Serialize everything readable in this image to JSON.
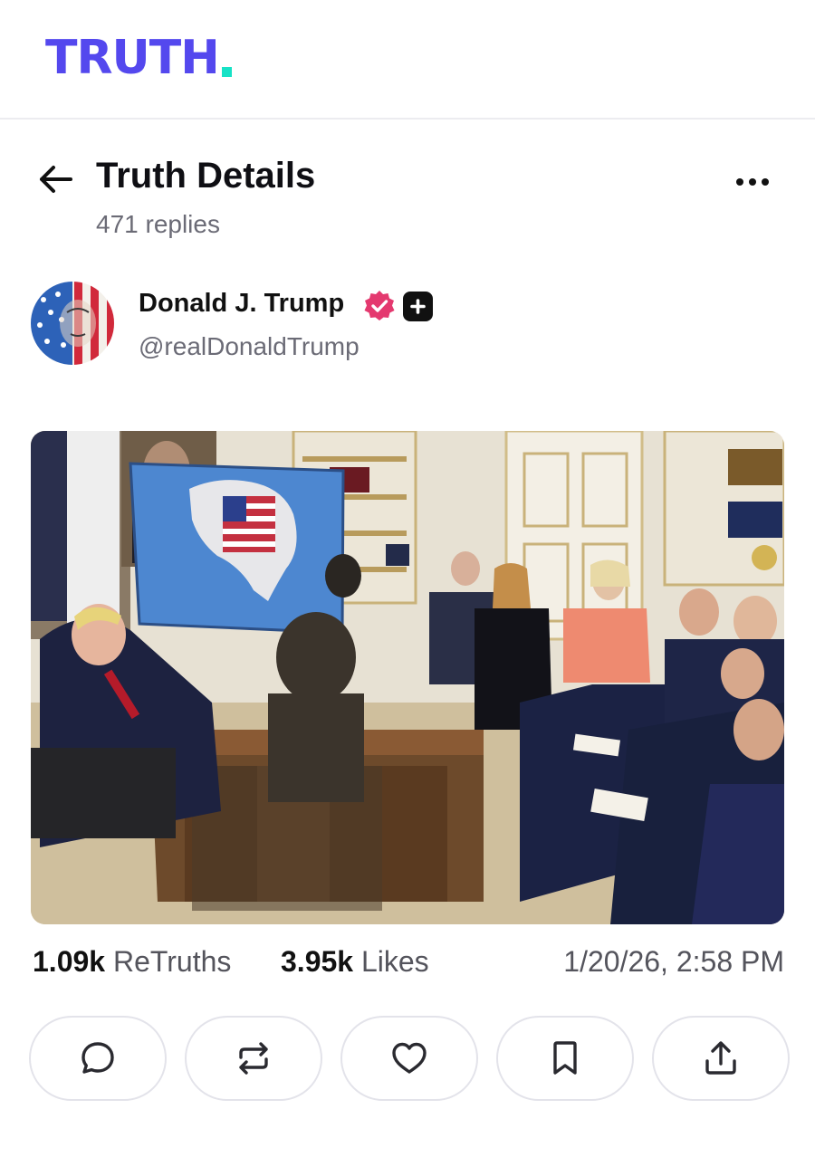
{
  "brand": {
    "logo_text": "TRUTH",
    "color_primary": "#5448ee",
    "color_dot": "#17e2c6"
  },
  "header": {
    "title": "Truth Details",
    "subtitle": "471 replies",
    "back_icon": "arrow-left-icon",
    "more_icon": "more-horizontal-icon"
  },
  "author": {
    "name": "Donald J. Trump",
    "handle": "@realDonaldTrump",
    "verified_color": "#e4396f"
  },
  "post": {
    "image_icon": "post-photo",
    "retruths_count": "1.09k",
    "retruths_label": "ReTruths",
    "likes_count": "3.95k",
    "likes_label": "Likes",
    "timestamp": "1/20/26, 2:58 PM"
  },
  "actions": [
    {
      "icon": "reply-icon"
    },
    {
      "icon": "retruth-icon"
    },
    {
      "icon": "like-icon"
    },
    {
      "icon": "bookmark-icon"
    },
    {
      "icon": "share-icon"
    }
  ]
}
